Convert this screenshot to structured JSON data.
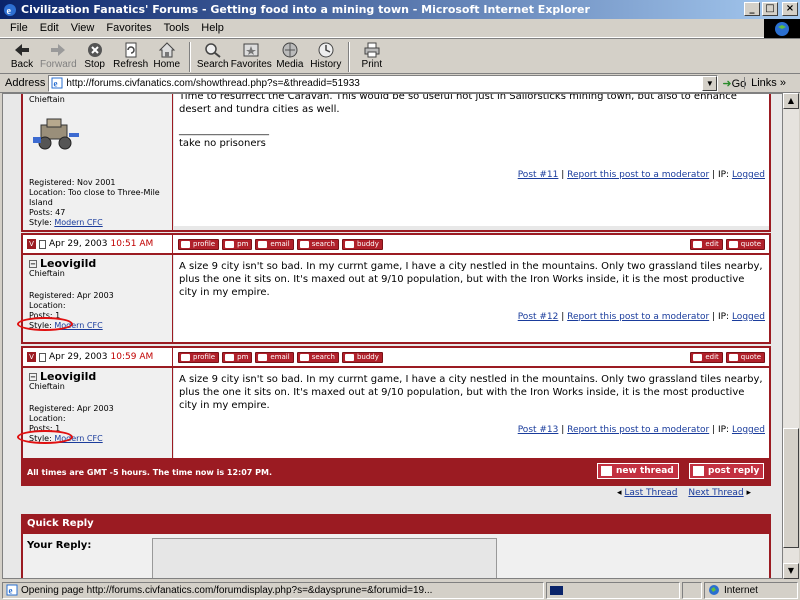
{
  "window": {
    "title": "Civilization Fanatics' Forums - Getting food into a mining town - Microsoft Internet Explorer",
    "buttons": [
      "_",
      "□",
      "×"
    ]
  },
  "menu": [
    "File",
    "Edit",
    "View",
    "Favorites",
    "Tools",
    "Help"
  ],
  "toolbar": [
    {
      "label": "Back",
      "icon": "back-arrow-icon",
      "enabled": true
    },
    {
      "label": "Forward",
      "icon": "forward-arrow-icon",
      "enabled": false
    },
    {
      "label": "Stop",
      "icon": "stop-icon",
      "enabled": true
    },
    {
      "label": "Refresh",
      "icon": "refresh-icon",
      "enabled": true
    },
    {
      "label": "Home",
      "icon": "home-icon",
      "enabled": true
    },
    {
      "label": "Search",
      "icon": "search-icon",
      "enabled": true
    },
    {
      "label": "Favorites",
      "icon": "favorites-icon",
      "enabled": true
    },
    {
      "label": "Media",
      "icon": "media-icon",
      "enabled": true
    },
    {
      "label": "History",
      "icon": "history-icon",
      "enabled": true
    },
    {
      "label": "Print",
      "icon": "print-icon",
      "enabled": true
    }
  ],
  "address": {
    "label": "Address",
    "url": "http://forums.civfanatics.com/showthread.php?s=&threadid=51933",
    "go": "Go",
    "links": "Links"
  },
  "post11": {
    "rank": "Chieftain",
    "registered": "Registered: Nov 2001",
    "location": "Location: Too close to Three-Mile Island",
    "posts": "Posts: 47",
    "style_label": "Style:",
    "style_value": "Modern CFC",
    "text1": "Time to resurrect the Caravan. This would be so useful not just in Sailorsticks mining town, but also to enhance desert and tundra cities as well.",
    "sig_line": "__________________",
    "sig": "take no prisoners",
    "link_post": "Post #11",
    "link_report": "Report this post to a moderator",
    "ip_label": "IP:",
    "ip_value": "Logged"
  },
  "post12": {
    "date": "Apr 29, 2003",
    "time": "10:51 AM",
    "username": "Leovigild",
    "rank": "Chieftain",
    "registered": "Registered: Apr 2003",
    "location": "Location:",
    "posts": "Posts: 1",
    "style_label": "Style:",
    "style_value": "Modern CFC",
    "text": "A size 9 city isn't so bad. In my currnt game, I have a city nestled in the mountains. Only two grassland tiles nearby, plus the one it sits on. It's maxed out at 9/10 population, but with the Iron Works inside, it is the most productive city in my empire.",
    "link_post": "Post #12",
    "link_report": "Report this post to a moderator",
    "ip_label": "IP:",
    "ip_value": "Logged"
  },
  "post13": {
    "date": "Apr 29, 2003",
    "time": "10:59 AM",
    "username": "Leovigild",
    "rank": "Chieftain",
    "registered": "Registered: Apr 2003",
    "location": "Location:",
    "posts": "Posts: 1",
    "style_label": "Style:",
    "style_value": "Modern CFC",
    "text": "A size 9 city isn't so bad. In my currnt game, I have a city nestled in the mountains. Only two grassland tiles nearby, plus the one it sits on. It's maxed out at 9/10 population, but with the Iron Works inside, it is the most productive city in my empire.",
    "link_post": "Post #13",
    "link_report": "Report this post to a moderator",
    "ip_label": "IP:",
    "ip_value": "Logged"
  },
  "post_buttons": [
    "profile",
    "pm",
    "email",
    "search",
    "buddy"
  ],
  "edit_buttons": [
    "edit",
    "quote"
  ],
  "footer": {
    "time_note": "All times are GMT -5 hours. The time now is 12:07 PM.",
    "new_thread": "new thread",
    "post_reply": "post reply",
    "last_thread": "Last Thread",
    "next_thread": "Next Thread"
  },
  "quick_reply": {
    "title": "Quick Reply",
    "your_reply": "Your Reply:"
  },
  "status": {
    "text": "Opening page http://forums.civfanatics.com/forumdisplay.php?s=&daysprune=&forumid=19...",
    "progress": 0.1,
    "zone": "Internet"
  },
  "colors": {
    "accent": "#9b1b22",
    "link": "#1a3c9c",
    "time": "#c00000",
    "highlight_circle": "#e01010"
  }
}
